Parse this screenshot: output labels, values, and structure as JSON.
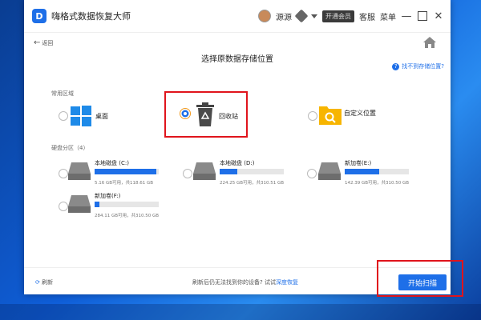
{
  "app": {
    "title": "嗨格式数据恢复大师",
    "logo_text": "D"
  },
  "titlebar": {
    "username": "源源",
    "vip_label": "开通会员",
    "service": "客服",
    "menu": "菜单",
    "minimize": "—",
    "close": "✕"
  },
  "nav": {
    "back": "返回"
  },
  "page": {
    "title": "选择原数据存储位置",
    "help": "找不到存储位置?"
  },
  "common": {
    "label": "常用区域",
    "items": [
      {
        "label": "桌面",
        "icon": "windows-icon"
      },
      {
        "label": "回收站",
        "icon": "recycle-bin-icon"
      },
      {
        "label": "自定义位置",
        "icon": "folder-search-icon"
      }
    ]
  },
  "disks": {
    "label": "硬盘分区（4）",
    "items": [
      {
        "name": "本地磁盘 (C:)",
        "size": "5.16 GB可用，共118.61 GB",
        "used_fraction": 0.96
      },
      {
        "name": "本地磁盘 (D:)",
        "size": "224.25 GB可用，共310.51 GB",
        "used_fraction": 0.28
      },
      {
        "name": "新加卷(E:)",
        "size": "142.39 GB可用，共310.50 GB",
        "used_fraction": 0.54
      },
      {
        "name": "新加卷(F:)",
        "size": "284.11 GB可用，共310.50 GB",
        "used_fraction": 0.08
      }
    ]
  },
  "footer": {
    "refresh": "刷新",
    "hint": "刷新后仍无法找到你的设备? 试试",
    "hint_link": "深度恢复",
    "scan": "开始扫描"
  },
  "colors": {
    "accent": "#1e6fe8",
    "highlight": "#e0141c"
  }
}
